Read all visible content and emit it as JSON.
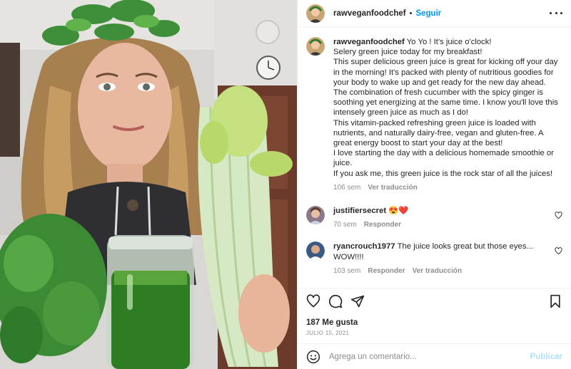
{
  "photo": {
    "alt_icon": "post-photo"
  },
  "header": {
    "username": "rawveganfoodchef",
    "separator": "•",
    "follow_label": "Seguir",
    "more_icon": "more-options-icon"
  },
  "caption": {
    "username": "rawveganfoodchef",
    "lines": [
      "Yo Yo ! It's juice o'clock!",
      "Selery green juice today for my breakfast!",
      "This super delicious green juice is great for kicking off your day in the morning! It's packed with plenty of nutritious goodies for your body to wake up and get ready for the new day ahead.",
      "The combination of fresh cucumber with the spicy ginger is soothing yet energizing at the same time. I know you'll love this intensely green juice as much as I do!",
      "This vitamin-packed refreshing green juice is loaded with nutrients, and naturally dairy-free, vegan and gluten-free.  A great energy boost to start your day at the best!",
      "I love starting the day with a delicious homemade smoothie or juice.",
      "If you ask me, this green juice is the rock star of all the juices!"
    ],
    "time": "106 sem",
    "translate_label": "Ver traducción"
  },
  "comments": [
    {
      "username": "justifiersecret",
      "text": "😍❤️",
      "time": "70 sem",
      "reply_label": "Responder",
      "translate_label": ""
    },
    {
      "username": "ryancrouch1977",
      "text": "The juice looks great but those eyes... WOW!!!!",
      "time": "103 sem",
      "reply_label": "Responder",
      "translate_label": "Ver traducción"
    }
  ],
  "actions": {
    "icons": [
      "heart-icon",
      "comment-icon",
      "share-icon",
      "bookmark-icon"
    ]
  },
  "likes": "187 Me gusta",
  "date": "JULIO 15, 2021",
  "add_comment": {
    "placeholder": "Agrega un comentario...",
    "post_label": "Publicar",
    "emoji_icon": "emoji-icon"
  },
  "colors": {
    "link": "#0095f6",
    "muted": "#8e8e8e",
    "text": "#262626",
    "post_disabled": "#b2dffc",
    "heart_red": "#ed4956"
  }
}
